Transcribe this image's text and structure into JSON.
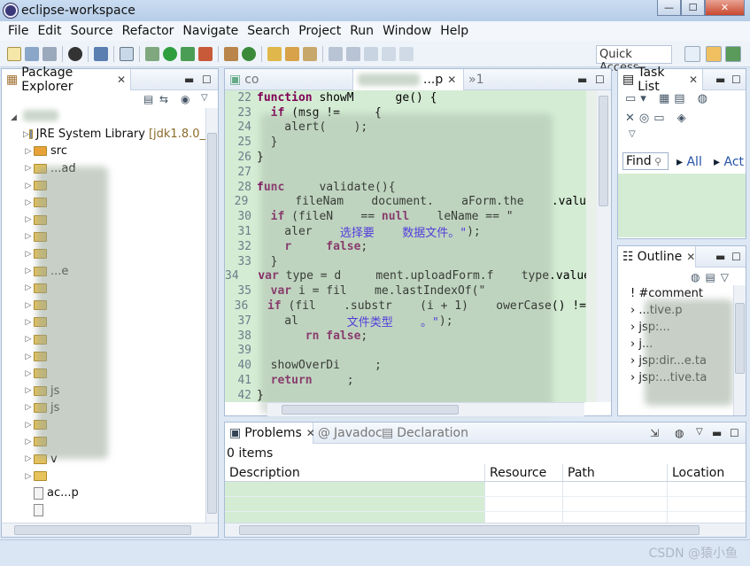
{
  "window": {
    "title": "eclipse-workspace",
    "min": "—",
    "max": "☐",
    "close": "✕"
  },
  "menu": [
    "File",
    "Edit",
    "Source",
    "Refactor",
    "Navigate",
    "Search",
    "Project",
    "Run",
    "Window",
    "Help"
  ],
  "toolbar": {
    "quick_access": "Quick Access"
  },
  "package_explorer": {
    "tab": "Package Explorer",
    "items": [
      {
        "label": "JRE System Library",
        "suffix": "[jdk1.8.0_",
        "kind": "library"
      },
      {
        "label": "src",
        "kind": "package"
      },
      {
        "label": "...ad",
        "kind": "folder"
      },
      {
        "label": "",
        "kind": "folder"
      },
      {
        "label": "",
        "kind": "folder"
      },
      {
        "label": "",
        "kind": "folder"
      },
      {
        "label": "",
        "kind": "folder"
      },
      {
        "label": "",
        "kind": "folder"
      },
      {
        "label": "...e",
        "kind": "folder"
      },
      {
        "label": "",
        "kind": "folder"
      },
      {
        "label": "",
        "kind": "folder"
      },
      {
        "label": "",
        "kind": "folder"
      },
      {
        "label": "",
        "kind": "folder"
      },
      {
        "label": "",
        "kind": "folder"
      },
      {
        "label": "",
        "kind": "folder"
      },
      {
        "label": "js",
        "kind": "folder"
      },
      {
        "label": "js",
        "kind": "folder"
      },
      {
        "label": "",
        "kind": "folder"
      },
      {
        "label": "",
        "kind": "folder"
      },
      {
        "label": "v",
        "kind": "folder"
      },
      {
        "label": "",
        "kind": "folder"
      },
      {
        "label": "ac...p",
        "kind": "file"
      },
      {
        "label": "",
        "kind": "file"
      }
    ]
  },
  "editor": {
    "tabs": [
      {
        "label": "co"
      },
      {
        "label": "...p"
      },
      {
        "label": "»1"
      }
    ],
    "lines": [
      {
        "n": "22",
        "parts": [
          [
            "kw",
            "function"
          ],
          [
            "ctx",
            " showM      ge() {"
          ]
        ]
      },
      {
        "n": "23",
        "parts": [
          [
            "ctx",
            "  "
          ],
          [
            "kw",
            "if"
          ],
          [
            "ctx",
            " (msg !=     {"
          ]
        ]
      },
      {
        "n": "24",
        "parts": [
          [
            "ctx",
            "    alert(    );"
          ]
        ]
      },
      {
        "n": "25",
        "parts": [
          [
            "ctx",
            "  }"
          ]
        ]
      },
      {
        "n": "26",
        "parts": [
          [
            "ctx",
            "}"
          ]
        ]
      },
      {
        "n": "27",
        "parts": [
          [
            "ctx",
            ""
          ]
        ]
      },
      {
        "n": "28",
        "parts": [
          [
            "kw",
            "func"
          ],
          [
            "ctx",
            "     validate(){"
          ]
        ]
      },
      {
        "n": "29",
        "parts": [
          [
            "ctx",
            "      fileNam    document.    aForm.the    .valu"
          ]
        ]
      },
      {
        "n": "30",
        "parts": [
          [
            "ctx",
            "  "
          ],
          [
            "kw",
            "if"
          ],
          [
            "ctx",
            " (fileN    == "
          ],
          [
            "kw",
            "null"
          ],
          [
            "ctx",
            "    leName == \""
          ]
        ]
      },
      {
        "n": "31",
        "parts": [
          [
            "ctx",
            "    aler    "
          ],
          [
            "str",
            "选择要    数据文件。\""
          ],
          [
            "ctx",
            ");"
          ]
        ]
      },
      {
        "n": "32",
        "parts": [
          [
            "ctx",
            "    "
          ],
          [
            "kw",
            "r     false"
          ],
          [
            "ctx",
            ";"
          ]
        ]
      },
      {
        "n": "33",
        "parts": [
          [
            "ctx",
            "  }"
          ]
        ]
      },
      {
        "n": "34",
        "parts": [
          [
            "ctx",
            "  "
          ],
          [
            "kw",
            "var"
          ],
          [
            "ctx",
            " type = d     ment.uploadForm.f    type.value;"
          ]
        ]
      },
      {
        "n": "35",
        "parts": [
          [
            "ctx",
            "  "
          ],
          [
            "kw",
            "var"
          ],
          [
            "ctx",
            " i = fil    me.lastIndexOf(\""
          ]
        ]
      },
      {
        "n": "36",
        "parts": [
          [
            "ctx",
            "  "
          ],
          [
            "kw",
            "if"
          ],
          [
            "ctx",
            " (fil    .substr    (i + 1)    owerCase() !="
          ]
        ]
      },
      {
        "n": "37",
        "parts": [
          [
            "ctx",
            "    al       "
          ],
          [
            "str",
            "文件类型    。\""
          ],
          [
            "ctx",
            ");"
          ]
        ]
      },
      {
        "n": "38",
        "parts": [
          [
            "ctx",
            "    "
          ],
          [
            "kw",
            "   rn false"
          ],
          [
            "ctx",
            ";"
          ]
        ]
      },
      {
        "n": "39",
        "parts": [
          [
            "ctx",
            ""
          ]
        ]
      },
      {
        "n": "40",
        "parts": [
          [
            "ctx",
            "  showOverDi     ;"
          ]
        ]
      },
      {
        "n": "41",
        "parts": [
          [
            "ctx",
            "  "
          ],
          [
            "kw",
            "return"
          ],
          [
            "ctx",
            "     ;"
          ]
        ]
      },
      {
        "n": "42",
        "parts": [
          [
            "ctx",
            "}"
          ]
        ]
      }
    ]
  },
  "task_list": {
    "tab": "Task List",
    "find": "Find",
    "all": "All",
    "act": "Act"
  },
  "outline": {
    "tab": "Outline",
    "items": [
      "#comment",
      "...tive.p",
      "jsp:...",
      "j...",
      "jsp:dir...e.ta",
      "jsp:...tive.ta"
    ]
  },
  "problems": {
    "tabs": [
      "Problems",
      "Javadoc",
      "Declaration"
    ],
    "count": "0 items",
    "columns": [
      "Description",
      "Resource",
      "Path",
      "Location"
    ]
  },
  "status": {
    "watermark": "CSDN @猿小鱼"
  }
}
